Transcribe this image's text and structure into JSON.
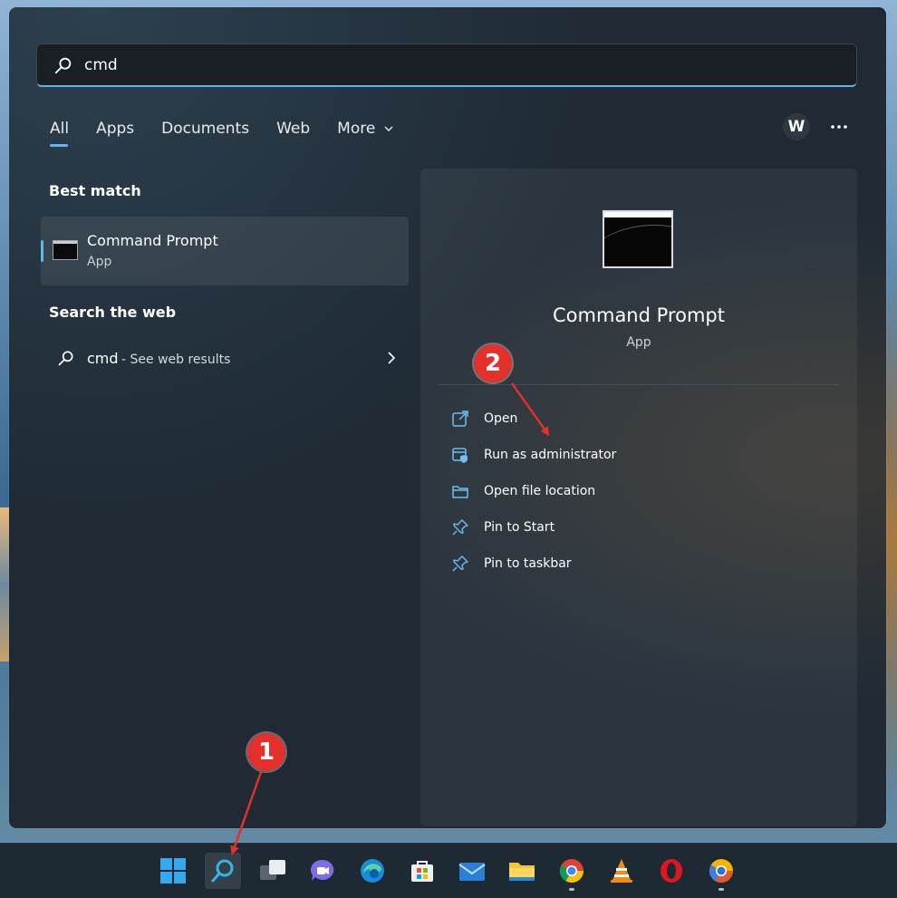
{
  "search": {
    "value": "cmd"
  },
  "tabs": [
    {
      "label": "All",
      "active": true
    },
    {
      "label": "Apps"
    },
    {
      "label": "Documents"
    },
    {
      "label": "Web"
    },
    {
      "label": "More"
    }
  ],
  "user": {
    "avatar_initial": "W"
  },
  "best_match": {
    "heading": "Best match",
    "title": "Command Prompt",
    "subtitle": "App"
  },
  "search_web": {
    "heading": "Search the web",
    "query": "cmd",
    "suffix": "- See web results"
  },
  "detail": {
    "title": "Command Prompt",
    "type": "App",
    "actions": [
      {
        "label": "Open",
        "icon": "open-external-icon"
      },
      {
        "label": "Run as administrator",
        "icon": "shield-admin-icon"
      },
      {
        "label": "Open file location",
        "icon": "folder-icon"
      },
      {
        "label": "Pin to Start",
        "icon": "pin-icon"
      },
      {
        "label": "Pin to taskbar",
        "icon": "pin-icon"
      }
    ]
  },
  "annotations": [
    {
      "number": "1",
      "color": "#e3302b"
    },
    {
      "number": "2",
      "color": "#e3302b"
    }
  ],
  "taskbar": {
    "icons": [
      "windows-start-icon",
      "search-icon",
      "task-view-icon",
      "teams-chat-icon",
      "edge-icon",
      "store-icon",
      "mail-icon",
      "file-explorer-icon",
      "chrome-icon",
      "vlc-icon",
      "opera-icon",
      "chrome-canary-icon"
    ]
  },
  "colors": {
    "accent": "#60b7f0",
    "panel": "#1f2a35",
    "annotation": "#e3302b"
  }
}
